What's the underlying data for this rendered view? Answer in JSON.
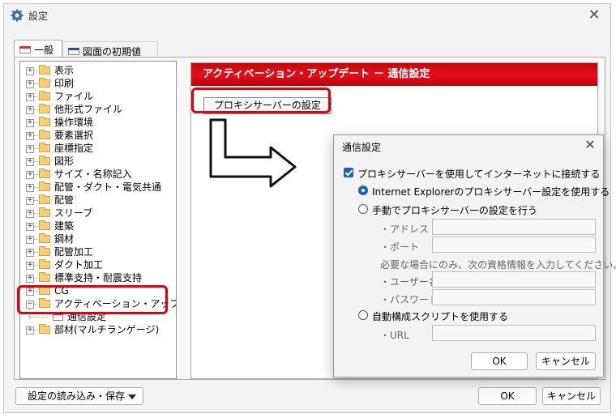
{
  "window": {
    "title": "設定",
    "close_glyph": "✕"
  },
  "tabs": [
    {
      "label": "一般",
      "active": true
    },
    {
      "label": "図面の初期値",
      "active": false
    }
  ],
  "tree": {
    "items": [
      "表示",
      "印刷",
      "ファイル",
      "他形式ファイル",
      "操作環境",
      "要素選択",
      "座標指定",
      "図形",
      "サイズ・名称記入",
      "配管・ダクト・電気共通",
      "配管",
      "スリーブ",
      "建築",
      "鋼材",
      "配管加工",
      "ダクト加工",
      "標準支持・耐震支持",
      "CG",
      "アクティベーション・アップデート"
    ],
    "child": "通信設定",
    "last_item": "部材(マルチランゲージ)",
    "expand_glyph": "+",
    "collapse_glyph": "−"
  },
  "content": {
    "header": "アクティベーション・アップデート － 通信設定",
    "proxy_button": "プロキシサーバーの設定"
  },
  "bottom": {
    "load_save": "設定の読み込み・保存",
    "ok": "OK",
    "cancel": "キャンセル"
  },
  "dialog": {
    "title": "通信設定",
    "close_glyph": "✕",
    "use_proxy": "プロキシサーバーを使用してインターネットに接続する",
    "use_ie": "Internet Explorerのプロキシサーバー設定を使用する",
    "manual": "手動でプロキシサーバーの設定を行う",
    "address_label": "・アドレス",
    "port_label": "・ポート",
    "cred_note": "必要な場合にのみ、次の資格情報を入力してください。",
    "user_label": "・ユーザー名",
    "password_label": "・パスワード",
    "auto_script": "自動構成スクリプトを使用する",
    "url_label": "・URL",
    "address": "",
    "port": "",
    "user": "",
    "password": "",
    "url": "",
    "ok": "OK",
    "cancel": "キャンセル"
  },
  "colors": {
    "accent_red": "#e00010",
    "header_red": "#d00813",
    "check_blue": "#1e5fbf"
  }
}
